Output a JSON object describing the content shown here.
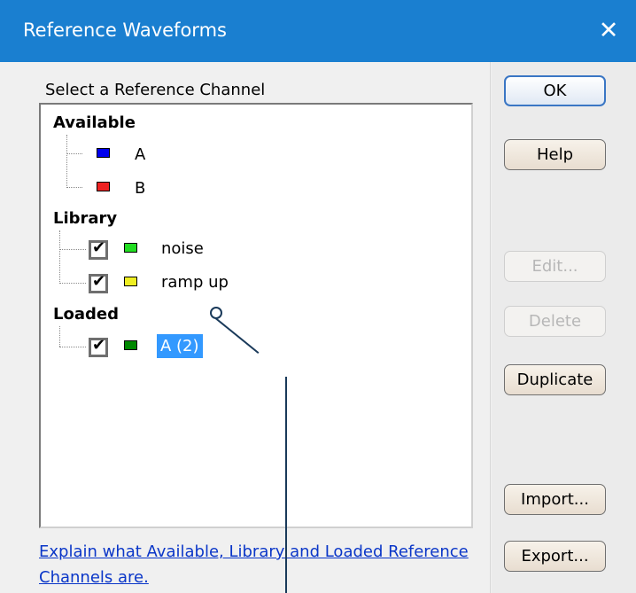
{
  "window": {
    "title": "Reference Waveforms",
    "close_glyph": "✕"
  },
  "group_label": "Select a Reference Channel",
  "tree": {
    "groups": [
      {
        "label": "Available",
        "items": [
          {
            "label": "A",
            "color": "#0000ee",
            "checkbox": false
          },
          {
            "label": "B",
            "color": "#ee2222",
            "checkbox": false
          }
        ]
      },
      {
        "label": "Library",
        "items": [
          {
            "label": "noise",
            "color": "#22dd22",
            "checkbox": true,
            "checked": true
          },
          {
            "label": "ramp up",
            "color": "#eeee22",
            "checkbox": true,
            "checked": true
          }
        ]
      },
      {
        "label": "Loaded",
        "items": [
          {
            "label": "A (2)",
            "color": "#008800",
            "checkbox": true,
            "checked": true,
            "selected": true
          }
        ]
      }
    ]
  },
  "help_link": "Explain what Available, Library and Loaded Reference Channels are.",
  "buttons": {
    "ok": "OK",
    "help": "Help",
    "edit": "Edit...",
    "delete": "Delete",
    "duplicate": "Duplicate",
    "import": "Import...",
    "export": "Export..."
  },
  "icons": {
    "check": "✔"
  },
  "colors": {
    "titlebar": "#1a7fd0",
    "selection": "#3399ff",
    "link": "#0a36c8"
  }
}
